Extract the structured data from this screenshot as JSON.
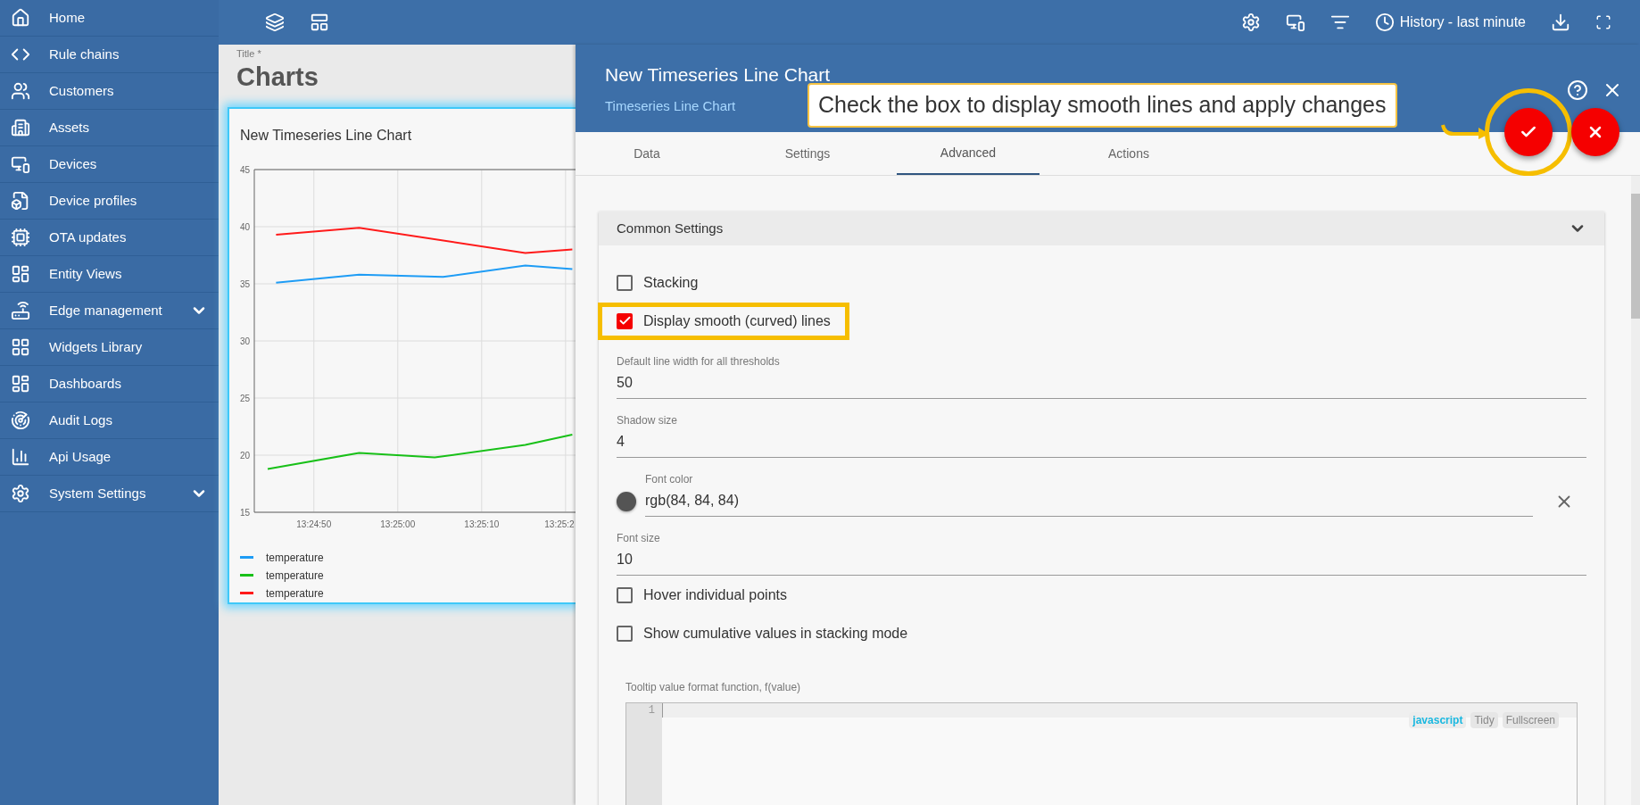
{
  "sidebar": {
    "items": [
      {
        "label": "Home",
        "expandable": false
      },
      {
        "label": "Rule chains",
        "expandable": false
      },
      {
        "label": "Customers",
        "expandable": false
      },
      {
        "label": "Assets",
        "expandable": false
      },
      {
        "label": "Devices",
        "expandable": false
      },
      {
        "label": "Device profiles",
        "expandable": false
      },
      {
        "label": "OTA updates",
        "expandable": false
      },
      {
        "label": "Entity Views",
        "expandable": false
      },
      {
        "label": "Edge management",
        "expandable": true
      },
      {
        "label": "Widgets Library",
        "expandable": false
      },
      {
        "label": "Dashboards",
        "expandable": false
      },
      {
        "label": "Audit Logs",
        "expandable": false
      },
      {
        "label": "Api Usage",
        "expandable": false
      },
      {
        "label": "System Settings",
        "expandable": true
      }
    ]
  },
  "toolbar": {
    "timewindow": "History - last minute"
  },
  "dashboard": {
    "title_label": "Title *",
    "title": "Charts",
    "widget": {
      "title": "New Timeseries Line Chart",
      "chart_data": {
        "type": "line",
        "grid": true,
        "xlim": [
          48282.9,
          48321.4
        ],
        "ylim": [
          15,
          45
        ],
        "yticks": [
          15,
          20,
          25,
          30,
          35,
          40,
          45
        ],
        "xticks": [
          {
            "value": 48290,
            "label": "13:24:50"
          },
          {
            "value": 48300,
            "label": "13:25:00"
          },
          {
            "value": 48310,
            "label": "13:25:10"
          },
          {
            "value": 48320,
            "label": "13:25:2"
          }
        ],
        "series": [
          {
            "name": "temperature",
            "color": "#1e9cf5",
            "x": [
              48285.5,
              48295.4,
              48305.4,
              48315.2,
              48320.8
            ],
            "values": [
              35.1,
              35.8,
              35.6,
              36.6,
              36.3
            ]
          },
          {
            "name": "temperature",
            "color": "#18c018",
            "x": [
              48284.5,
              48295.4,
              48304.4,
              48315.2,
              48320.8
            ],
            "values": [
              18.8,
              20.2,
              19.8,
              20.9,
              21.8
            ]
          },
          {
            "name": "temperature",
            "color": "#ff1a1a",
            "x": [
              48285.5,
              48295.4,
              48315.2,
              48320.8
            ],
            "values": [
              39.3,
              39.9,
              37.7,
              38.0
            ]
          }
        ]
      }
    }
  },
  "panel": {
    "title": "New Timeseries Line Chart",
    "subtitle": "Timeseries Line Chart",
    "tabs": [
      {
        "label": "Data",
        "selected": false
      },
      {
        "label": "Settings",
        "selected": false
      },
      {
        "label": "Advanced",
        "selected": true
      },
      {
        "label": "Actions",
        "selected": false
      }
    ],
    "section": {
      "title": "Common Settings",
      "expanded": true
    },
    "fields": [
      {
        "kind": "checkbox",
        "label": "Stacking",
        "checked": false,
        "highlighted": false
      },
      {
        "kind": "checkbox",
        "label": "Display smooth (curved) lines",
        "checked": true,
        "highlighted": true
      },
      {
        "kind": "text",
        "label": "Default line width for all thresholds",
        "value": "50"
      },
      {
        "kind": "text",
        "label": "Shadow size",
        "value": "4"
      },
      {
        "kind": "color",
        "label": "Font color",
        "value": "rgb(84, 84, 84)",
        "color": "#545454"
      },
      {
        "kind": "text",
        "label": "Font size",
        "value": "10"
      },
      {
        "kind": "checkbox",
        "label": "Hover individual points",
        "checked": false,
        "highlighted": false
      },
      {
        "kind": "checkbox",
        "label": "Show cumulative values in stacking mode",
        "checked": false,
        "highlighted": false
      }
    ],
    "editor": {
      "label": "Tooltip value format function, f(value)",
      "line_numbers": [
        "1"
      ],
      "mode": "javascript",
      "buttons": [
        "Tidy",
        "Fullscreen"
      ]
    }
  },
  "callout": {
    "text": "Check the box to display smooth lines and apply changes"
  }
}
